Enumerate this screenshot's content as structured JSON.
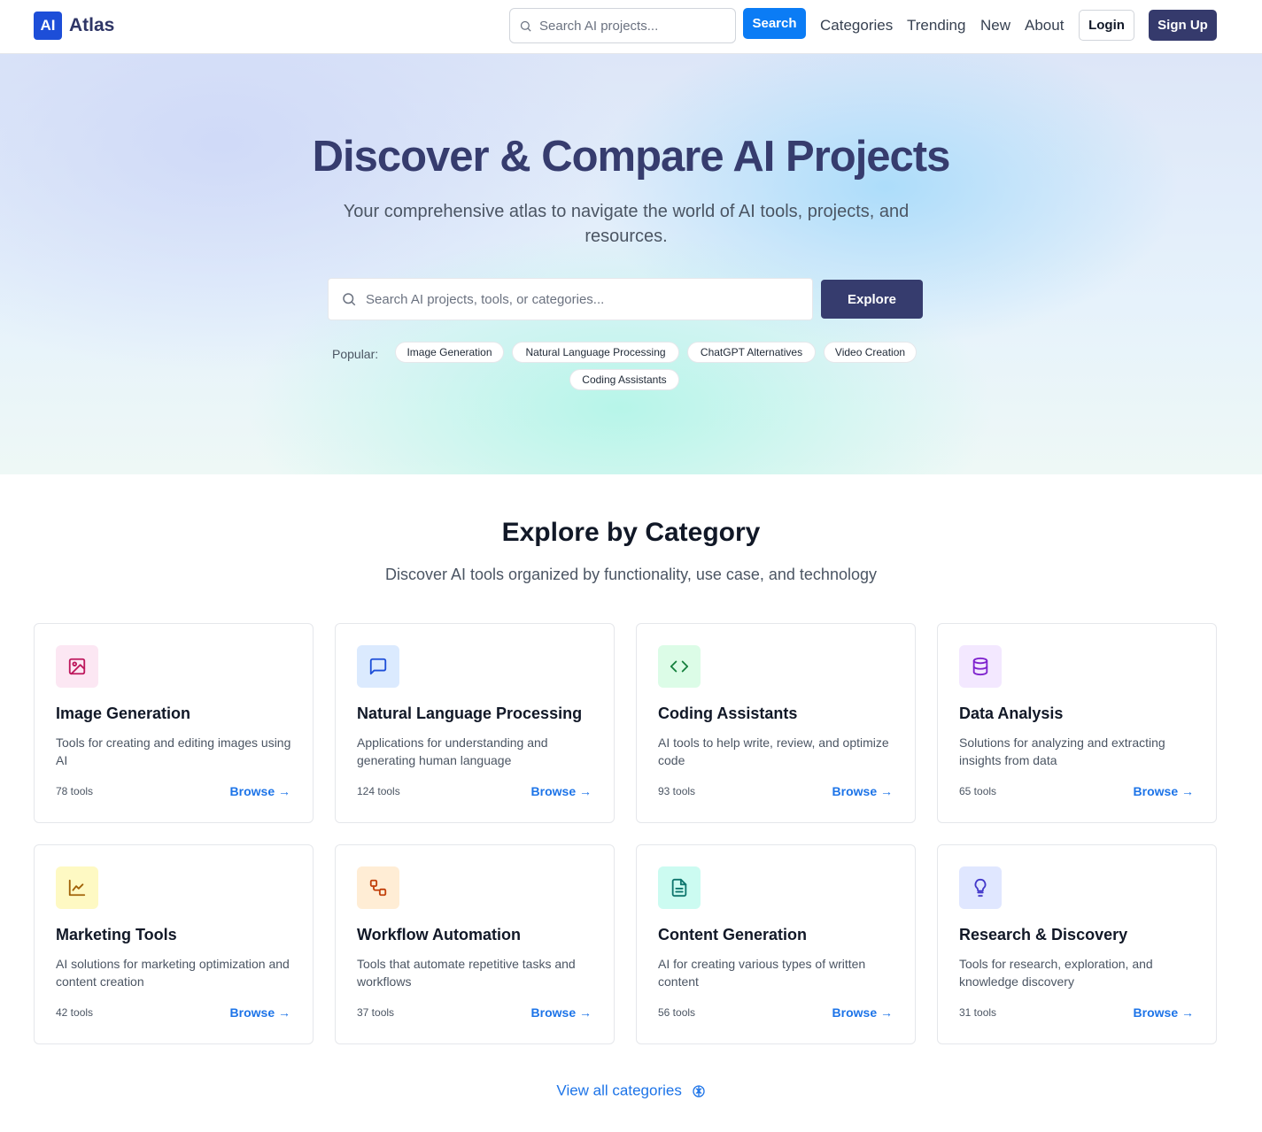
{
  "nav": {
    "logo_badge": "AI",
    "logo_text": "Atlas",
    "search_placeholder": "Search AI projects...",
    "search_button": "Search",
    "links": [
      "Categories",
      "Trending",
      "New",
      "About"
    ],
    "login": "Login",
    "signup": "Sign Up"
  },
  "hero": {
    "title": "Discover & Compare AI Projects",
    "subtitle": "Your comprehensive atlas to navigate the world of AI tools, projects, and resources.",
    "search_placeholder": "Search AI projects, tools, or categories...",
    "explore_button": "Explore",
    "popular_label": "Popular:",
    "popular_tags": [
      "Image Generation",
      "Natural Language Processing",
      "ChatGPT Alternatives",
      "Video Creation",
      "Coding Assistants"
    ]
  },
  "categories": {
    "title": "Explore by Category",
    "subtitle": "Discover AI tools organized by functionality, use case, and technology",
    "browse_label": "Browse →",
    "items": [
      {
        "title": "Image Generation",
        "desc": "Tools for creating and editing images using AI",
        "count": "78 tools",
        "icon": "image-icon",
        "icon_bg": "#fce7f3",
        "icon_color": "#be185d"
      },
      {
        "title": "Natural Language Processing",
        "desc": "Applications for understanding and generating human language",
        "count": "124 tools",
        "icon": "chat-bubble-icon",
        "icon_bg": "#dbeafe",
        "icon_color": "#1d4ed8"
      },
      {
        "title": "Coding Assistants",
        "desc": "AI tools to help write, review, and optimize code",
        "count": "93 tools",
        "icon": "code-icon",
        "icon_bg": "#dcfce7",
        "icon_color": "#15803d"
      },
      {
        "title": "Data Analysis",
        "desc": "Solutions for analyzing and extracting insights from data",
        "count": "65 tools",
        "icon": "database-icon",
        "icon_bg": "#f3e8ff",
        "icon_color": "#7e22ce"
      },
      {
        "title": "Marketing Tools",
        "desc": "AI solutions for marketing optimization and content creation",
        "count": "42 tools",
        "icon": "line-chart-icon",
        "icon_bg": "#fef9c3",
        "icon_color": "#a16207"
      },
      {
        "title": "Workflow Automation",
        "desc": "Tools that automate repetitive tasks and workflows",
        "count": "37 tools",
        "icon": "workflow-icon",
        "icon_bg": "#ffedd5",
        "icon_color": "#c2410c"
      },
      {
        "title": "Content Generation",
        "desc": "AI for creating various types of written content",
        "count": "56 tools",
        "icon": "document-icon",
        "icon_bg": "#ccfbf1",
        "icon_color": "#0f766e"
      },
      {
        "title": "Research & Discovery",
        "desc": "Tools for research, exploration, and knowledge discovery",
        "count": "31 tools",
        "icon": "lightbulb-icon",
        "icon_bg": "#e0e7ff",
        "icon_color": "#4338ca"
      }
    ],
    "view_all": "View all categories"
  }
}
